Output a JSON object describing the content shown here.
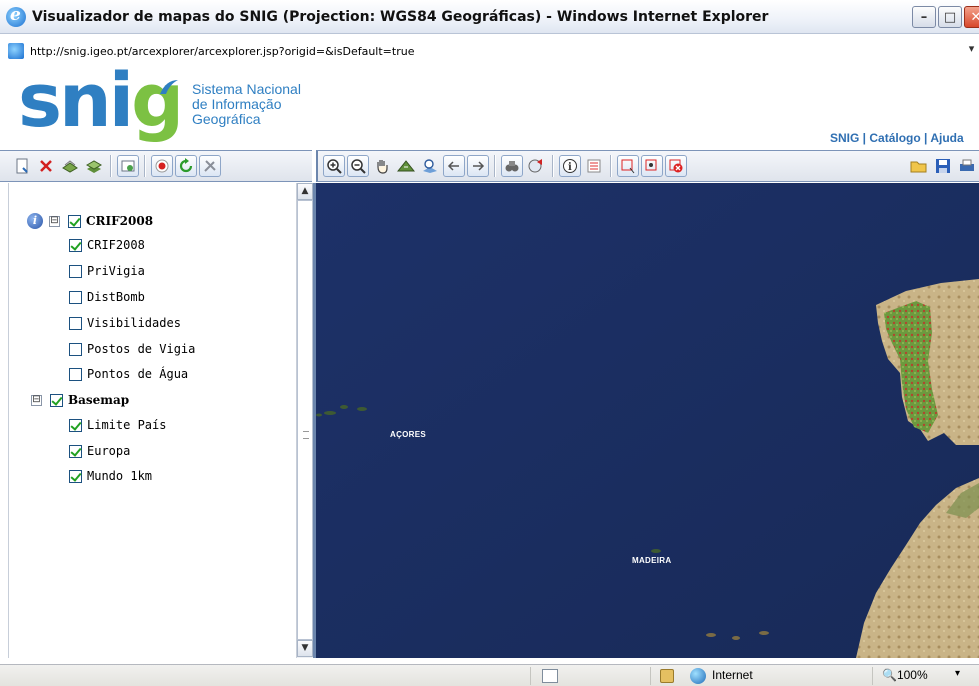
{
  "window": {
    "title": "Visualizador de mapas do SNIG (Projection: WGS84 Geográficas) - Windows Internet Explorer",
    "min_glyph": "–",
    "max_glyph": "□",
    "close_glyph": "✕"
  },
  "address": {
    "url": "http://snig.igeo.pt/arcexplorer/arcexplorer.jsp?origid=&isDefault=true"
  },
  "header": {
    "logo_s": "s",
    "logo_ni": "ni",
    "logo_g": "g",
    "logo_line1": "Sistema Nacional",
    "logo_line2": "de Informação",
    "logo_line3": "Geográfica",
    "links": [
      {
        "label": "SNIG"
      },
      {
        "label": "Catálogo"
      },
      {
        "label": "Ajuda"
      }
    ],
    "link_separator": " | "
  },
  "toc": {
    "groups": [
      {
        "label": "CRIF2008",
        "checked": true,
        "layers": [
          {
            "label": "CRIF2008",
            "checked": true
          },
          {
            "label": "PriVigia",
            "checked": false
          },
          {
            "label": "DistBomb",
            "checked": false
          },
          {
            "label": "Visibilidades",
            "checked": false
          },
          {
            "label": "Postos de Vigia",
            "checked": false
          },
          {
            "label": "Pontos de Água",
            "checked": false
          }
        ]
      },
      {
        "label": "Basemap",
        "checked": true,
        "layers": [
          {
            "label": "Limite País",
            "checked": true
          },
          {
            "label": "Europa",
            "checked": true
          },
          {
            "label": "Mundo 1km",
            "checked": true
          }
        ]
      }
    ],
    "expander_glyph": "⊟",
    "info_glyph": "i",
    "scroll_up": "▲",
    "scroll_down": "▼"
  },
  "map": {
    "labels": {
      "acores": "AÇORES",
      "madeira": "MADEIRA"
    },
    "colors": {
      "ocean": "#1c2f63",
      "land": "#c9b487",
      "vegetation": "#5d8a3a",
      "fire_risk": "#b2452e"
    }
  },
  "statusbar": {
    "zone": "Internet",
    "zoom": "100%",
    "zoom_drop": "▾"
  },
  "icons": {
    "left_toolbar": [
      "new-layer-icon",
      "delete-icon",
      "add-layer-icon",
      "layers-icon",
      "separator",
      "refresh-layer-icon",
      "separator",
      "record-icon",
      "reload-icon",
      "tools-icon"
    ],
    "map_toolbar": [
      "zoom-in-icon",
      "zoom-out-icon",
      "pan-icon",
      "full-extent-icon",
      "zoom-layer-icon",
      "back-icon",
      "forward-icon",
      "separator",
      "find-icon",
      "locate-icon",
      "separator",
      "identify-icon",
      "legend-icon",
      "separator",
      "select-rect-icon",
      "select-point-icon",
      "clear-selection-icon",
      "spacer",
      "open-icon",
      "save-icon",
      "print-icon"
    ]
  }
}
